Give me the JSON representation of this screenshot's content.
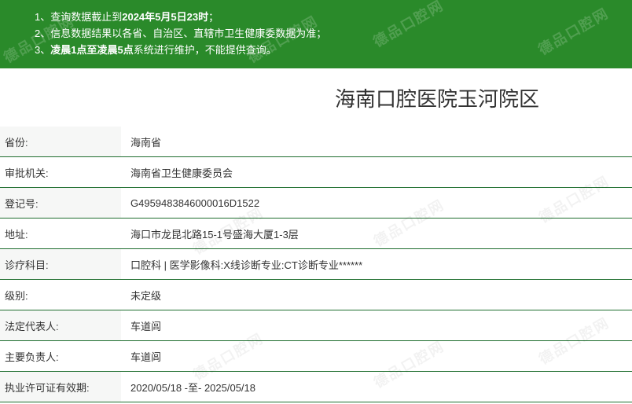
{
  "notice": {
    "line1_prefix": "1、查询数据截止到",
    "line1_bold": "2024年5月5日23时",
    "line1_suffix": "；",
    "line2": "2、信息数据结果以各省、自治区、直辖市卫生健康委数据为准；",
    "line3_prefix": "3、",
    "line3_bold": "凌晨1点至凌晨5点",
    "line3_suffix": "系统进行维护，不能提供查询。"
  },
  "watermark_text": "德品口腔网",
  "title": "海南口腔医院玉河院区",
  "rows": [
    {
      "label": "省份:",
      "value": "海南省"
    },
    {
      "label": "审批机关:",
      "value": "海南省卫生健康委员会"
    },
    {
      "label": "登记号:",
      "value": "G4959483846000016D1522"
    },
    {
      "label": "地址:",
      "value": "海口市龙昆北路15-1号盛海大厦1-3层"
    },
    {
      "label": "诊疗科目:",
      "value": "口腔科 | 医学影像科:X线诊断专业:CT诊断专业******"
    },
    {
      "label": "级别:",
      "value": "未定级"
    },
    {
      "label": "法定代表人:",
      "value": "车道闾"
    },
    {
      "label": "主要负责人:",
      "value": "车道闾"
    },
    {
      "label": "执业许可证有效期:",
      "value": "2020/05/18 -至- 2025/05/18"
    }
  ],
  "colors": {
    "header_green": "#2a8a2a",
    "row_border": "#1f6e2f"
  }
}
